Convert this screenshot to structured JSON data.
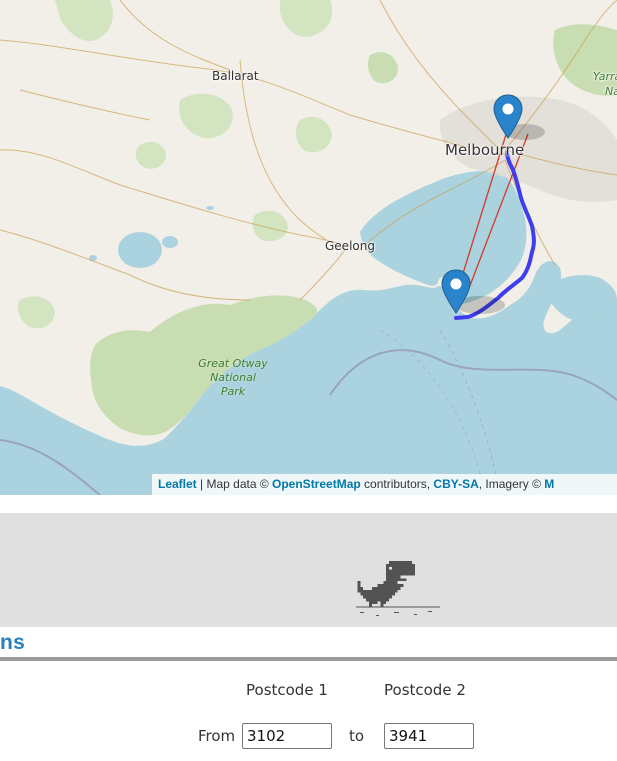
{
  "map": {
    "places": {
      "ballarat": "Ballarat",
      "melbourne": "Melbourne",
      "geelong": "Geelong",
      "yarra": "Yarra",
      "yarra_partial": "Na"
    },
    "park": [
      "Great Otway",
      "National",
      "Park"
    ],
    "attribution": {
      "leaflet": "Leaflet",
      "sep": " | Map data © ",
      "osm": "OpenStreetMap",
      "contrib": " contributors, ",
      "license": "CBY-SA",
      "imagery": ", Imagery © ",
      "tail": "M"
    },
    "colors": {
      "sea": "#aad3df",
      "land": "#f2efe9",
      "park": "#c8deb2",
      "route": "#3f3df0",
      "line": "#d23a2a",
      "marker": "#2a84cb"
    }
  },
  "offline": {
    "icon": "dino-icon"
  },
  "section": {
    "title": "ns"
  },
  "form": {
    "postcode1_header": "Postcode 1",
    "postcode2_header": "Postcode 2",
    "from_label": "From",
    "to_label": "to",
    "from_value": "3102",
    "to_value": "3941"
  }
}
